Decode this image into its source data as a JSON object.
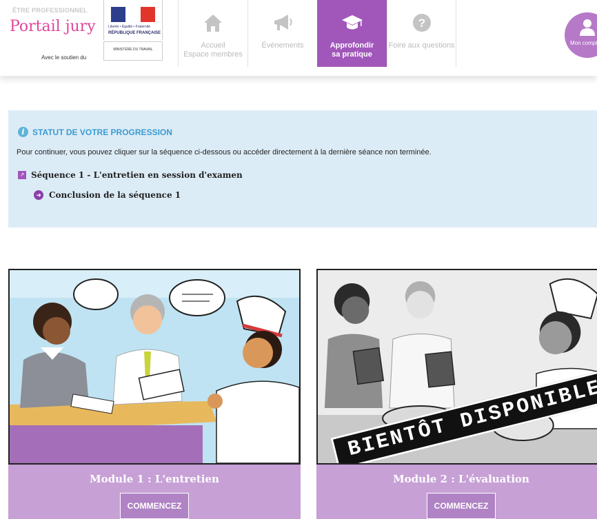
{
  "brand": {
    "small_title": "ÊTRE PROFESSIONNEL",
    "title": "Portail jury",
    "support": "Avec le soutien du",
    "gov_line1": "Liberté • Égalité • Fraternité",
    "gov_line2": "RÉPUBLIQUE FRANÇAISE",
    "ministry": "MINISTÈRE DU TRAVAIL"
  },
  "nav": {
    "home_label_1": "Accueil",
    "home_label_2": "Espace membres",
    "events_label": "Événements",
    "deepen_label_1": "Approfondir",
    "deepen_label_2": "sa pratique",
    "faq_label": "Foire aux questions"
  },
  "account": {
    "label": "Mon compte"
  },
  "progress": {
    "title": "STATUT DE VOTRE PROGRESSION",
    "description": "Pour continuer, vous pouvez cliquer sur la séquence ci-dessous ou accéder directement à la dernière séance non terminée.",
    "sequence": "Séquence 1 - L'entretien en session d'examen",
    "conclusion": "Conclusion de la séquence 1"
  },
  "modules": [
    {
      "title": "Module 1 : L'entretien",
      "button": "COMMENCEZ"
    },
    {
      "title": "Module 2 : L'évaluation",
      "button": "COMMENCEZ",
      "stamp": "BIENTÔT DISPONIBLE"
    }
  ],
  "colors": {
    "accent": "#a157ba",
    "brand_pink": "#e0459a",
    "info_blue": "#3b9bd0",
    "panel": "#dcecf7",
    "module_footer": "#c7a0d6"
  }
}
